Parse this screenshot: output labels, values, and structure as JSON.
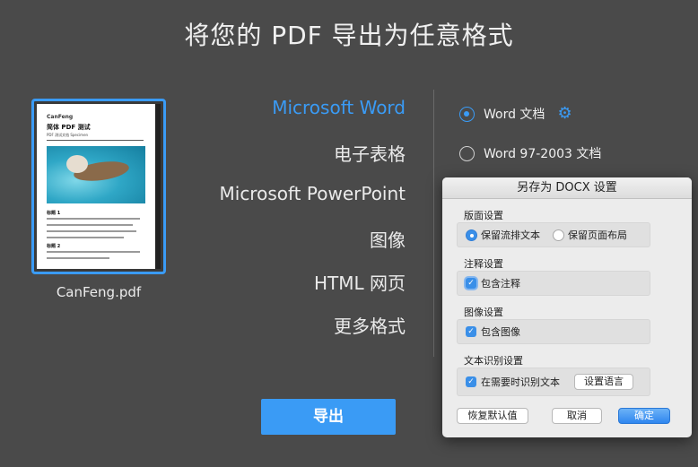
{
  "header": {
    "title": "将您的 PDF 导出为任意格式"
  },
  "preview": {
    "file_name": "CanFeng.pdf",
    "page_small": "CanFeng",
    "page_heading": "简体 PDF 测试",
    "page_sub": "PDF 测试文档 Specimen",
    "section_1": "标题 1",
    "section_2": "标题 2"
  },
  "formats": {
    "items": [
      {
        "label": "Microsoft Word",
        "selected": true
      },
      {
        "label": "电子表格",
        "selected": false
      },
      {
        "label": "Microsoft PowerPoint",
        "selected": false
      },
      {
        "label": "图像",
        "selected": false
      },
      {
        "label": "HTML 网页",
        "selected": false
      },
      {
        "label": "更多格式",
        "selected": false
      }
    ]
  },
  "options": {
    "word_doc": "Word 文档",
    "word_97": "Word 97-2003 文档",
    "settings_icon": "gear-icon"
  },
  "export_button": "导出",
  "dialog": {
    "title": "另存为 DOCX 设置",
    "layout_label": "版面设置",
    "layout_opt1": "保留流排文本",
    "layout_opt2": "保留页面布局",
    "comments_label": "注释设置",
    "comments_opt": "包含注释",
    "images_label": "图像设置",
    "images_opt": "包含图像",
    "ocr_label": "文本识别设置",
    "ocr_opt": "在需要时识别文本",
    "ocr_lang_button": "设置语言",
    "restore_button": "恢复默认值",
    "cancel_button": "取消",
    "ok_button": "确定"
  },
  "colors": {
    "accent": "#3a9bf5",
    "background": "#4a4a4a"
  }
}
